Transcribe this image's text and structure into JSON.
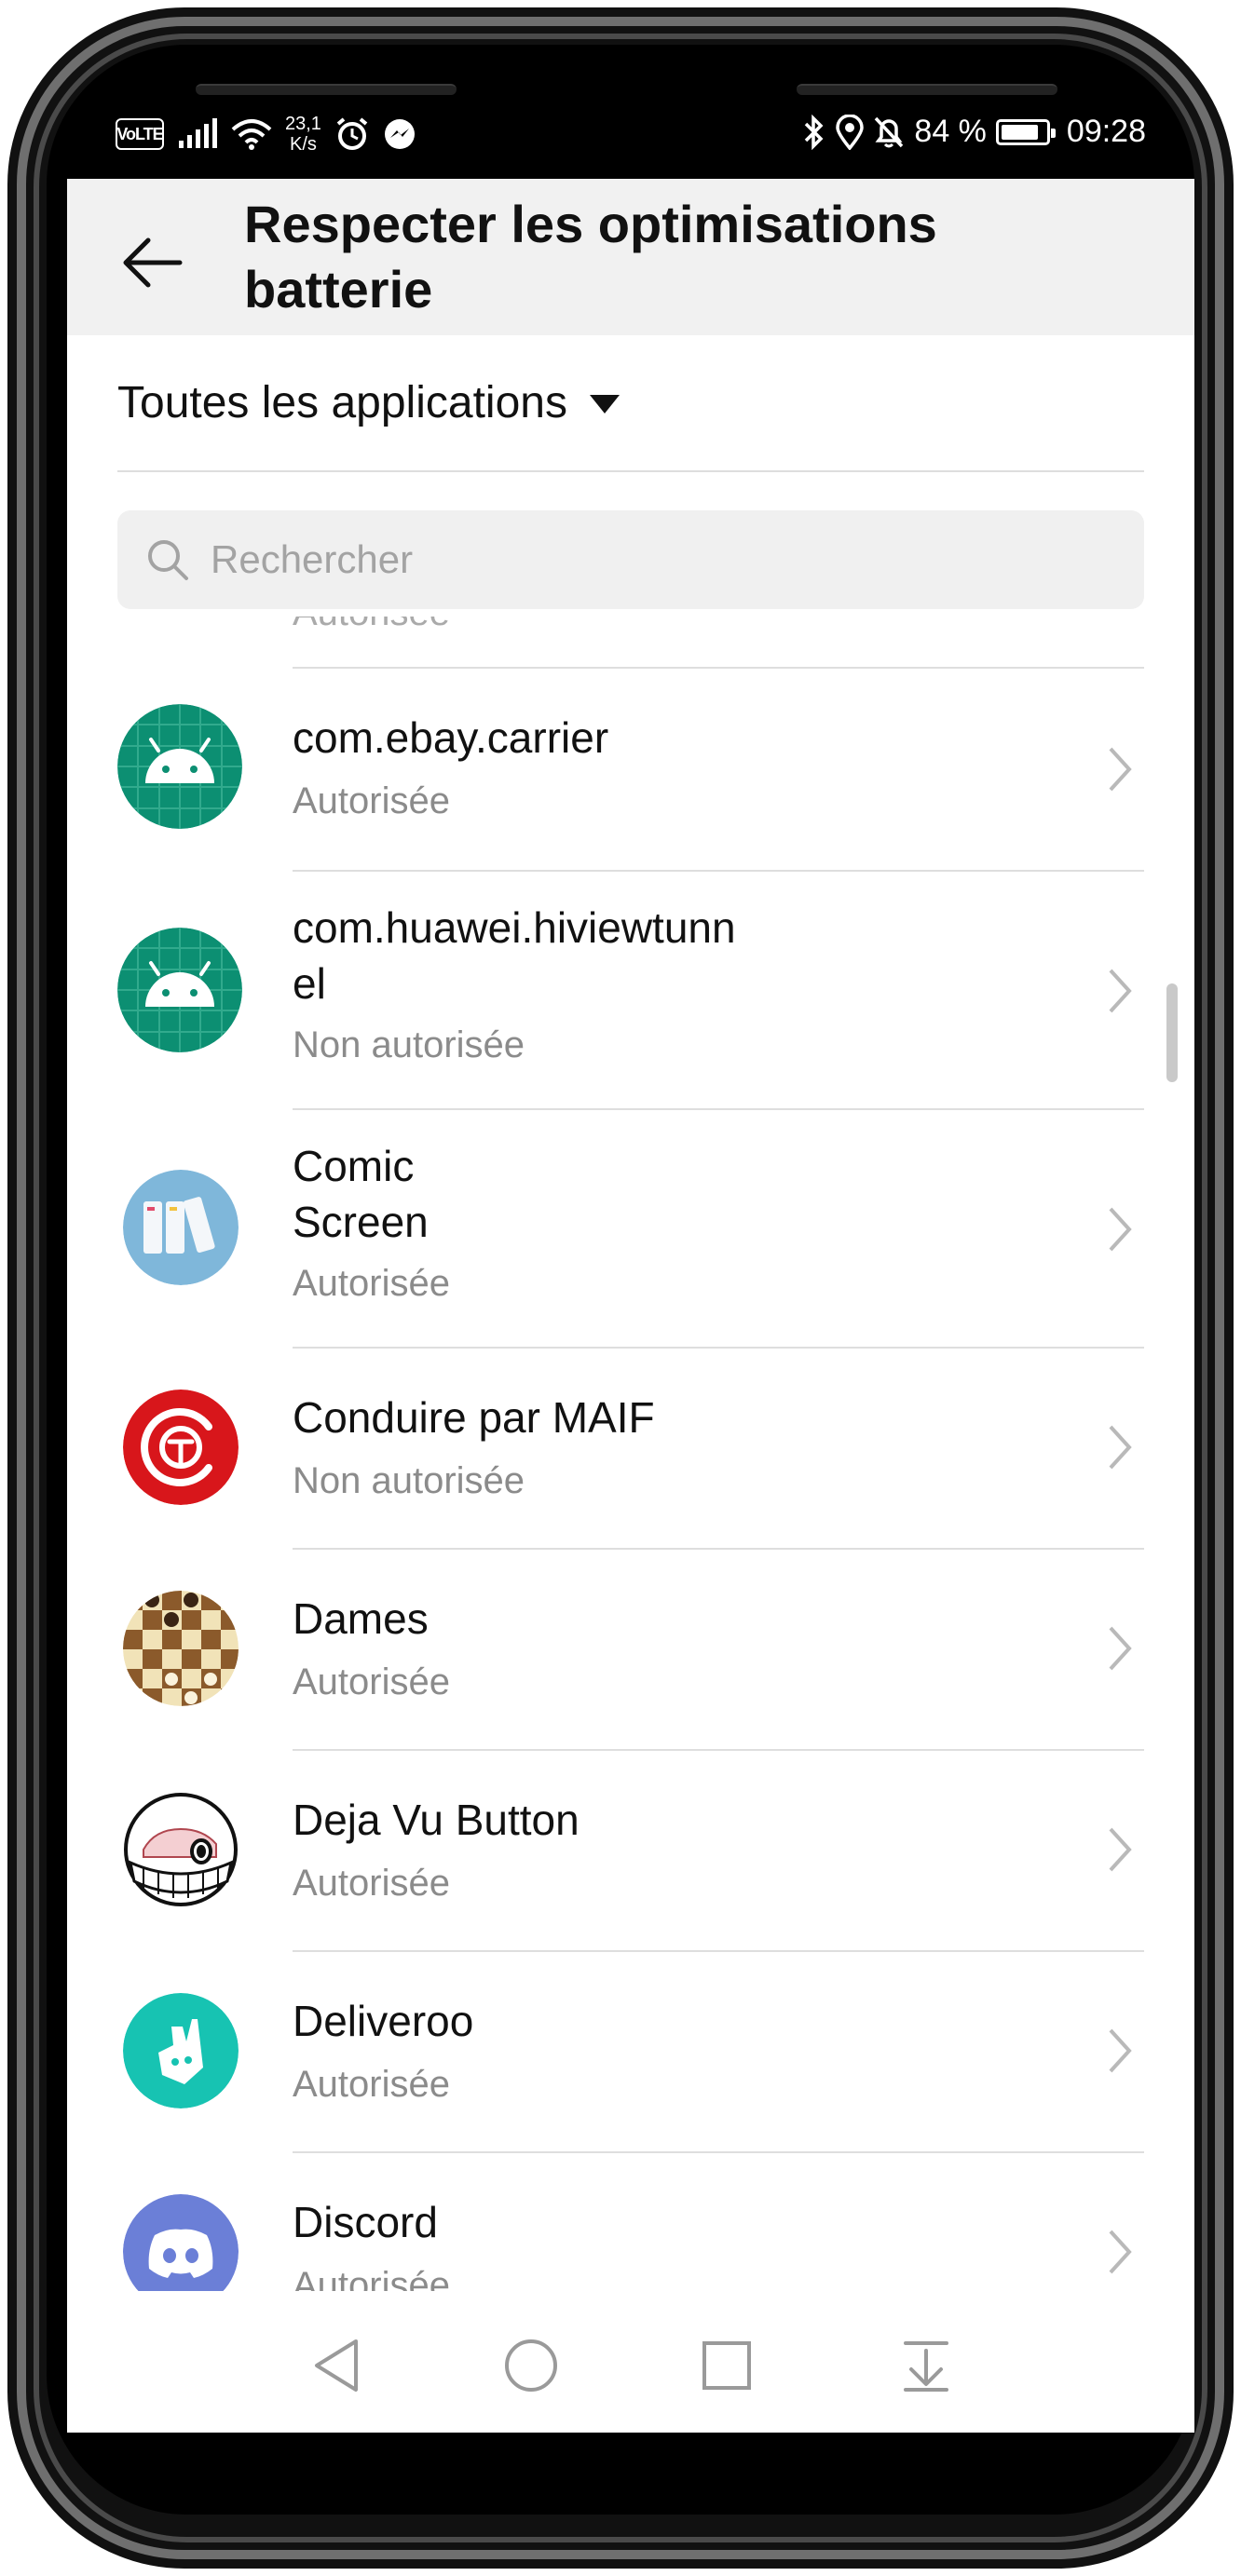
{
  "status_bar": {
    "volte": "VoLTE",
    "net_speed_value": "23,1",
    "net_speed_unit": "K/s",
    "battery_percent": "84 %",
    "battery_level": 0.84,
    "time": "09:28"
  },
  "header": {
    "title": "Respecter les optimisations batterie"
  },
  "filter": {
    "label": "Toutes les applications"
  },
  "search": {
    "placeholder": "Rechercher",
    "value": ""
  },
  "apps": [
    {
      "name": "com.ebay.carrier",
      "status": "Autorisée",
      "icon": "android-icon"
    },
    {
      "name": "com.huawei.hiviewtunn\nel",
      "status": "Non autorisée",
      "icon": "android-icon"
    },
    {
      "name": "Comic\nScreen",
      "status": "Autorisée",
      "icon": "comic-screen-icon"
    },
    {
      "name": "Conduire par MAIF",
      "status": "Non autorisée",
      "icon": "maif-icon"
    },
    {
      "name": "Dames",
      "status": "Autorisée",
      "icon": "checkers-icon"
    },
    {
      "name": "Deja Vu Button",
      "status": "Autorisée",
      "icon": "deja-vu-button-icon"
    },
    {
      "name": "Deliveroo",
      "status": "Autorisée",
      "icon": "deliveroo-icon"
    },
    {
      "name": "Discord",
      "status": "Autorisée",
      "icon": "discord-icon"
    }
  ],
  "colors": {
    "android_green": "#0c8f72",
    "maif_red": "#d8161b",
    "deliveroo_teal": "#17c3b2",
    "discord_blurple": "#6b7fd7",
    "status_gray": "#8b8b8b"
  }
}
